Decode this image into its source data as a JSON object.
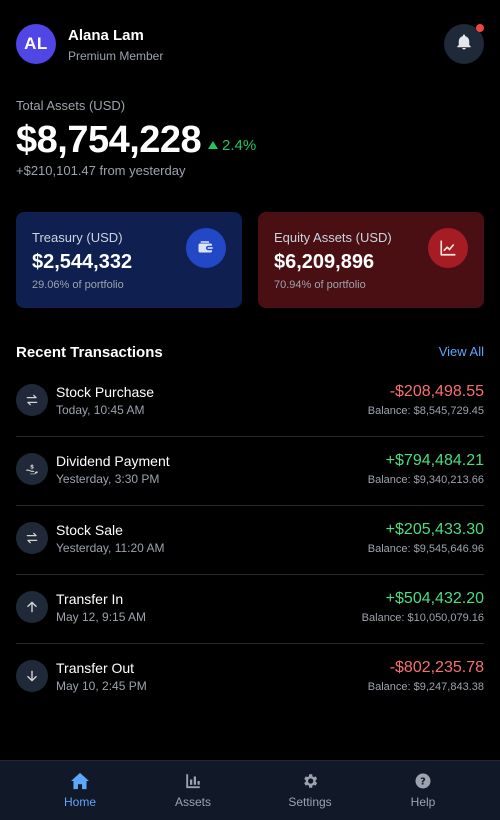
{
  "user": {
    "initials": "AL",
    "name": "Alana Lam",
    "tier": "Premium Member"
  },
  "notifications": {
    "icon": "bell-icon",
    "has_unread": true
  },
  "summary": {
    "label": "Total Assets (USD)",
    "value": "$8,754,228",
    "change_pct": "2.4%",
    "change_direction": "up",
    "change_abs": "+$210,101.47 from yesterday"
  },
  "cards": [
    {
      "label": "Treasury (USD)",
      "value": "$2,544,332",
      "sub": "29.06% of portfolio",
      "icon": "wallet-icon"
    },
    {
      "label": "Equity Assets (USD)",
      "value": "$6,209,896",
      "sub": "70.94% of portfolio",
      "icon": "chart-line-icon"
    }
  ],
  "transactions_section": {
    "title": "Recent Transactions",
    "view_all": "View All"
  },
  "transactions": [
    {
      "name": "Stock Purchase",
      "date": "Today, 10:45 AM",
      "amount": "-$208,498.55",
      "type": "neg",
      "balance": "Balance: $8,545,729.45",
      "icon": "exchange-icon"
    },
    {
      "name": "Dividend Payment",
      "date": "Yesterday, 3:30 PM",
      "amount": "+$794,484.21",
      "type": "pos",
      "balance": "Balance: $9,340,213.66",
      "icon": "hand-dollar-icon"
    },
    {
      "name": "Stock Sale",
      "date": "Yesterday, 11:20 AM",
      "amount": "+$205,433.30",
      "type": "pos",
      "balance": "Balance: $9,545,646.96",
      "icon": "exchange-icon"
    },
    {
      "name": "Transfer In",
      "date": "May 12, 9:15 AM",
      "amount": "+$504,432.20",
      "type": "pos",
      "balance": "Balance: $10,050,079.16",
      "icon": "arrow-up-icon"
    },
    {
      "name": "Transfer Out",
      "date": "May 10, 2:45 PM",
      "amount": "-$802,235.78",
      "type": "neg",
      "balance": "Balance: $9,247,843.38",
      "icon": "arrow-down-icon"
    }
  ],
  "nav": [
    {
      "label": "Home",
      "icon": "home-icon",
      "active": true
    },
    {
      "label": "Assets",
      "icon": "bar-chart-icon",
      "active": false
    },
    {
      "label": "Settings",
      "icon": "gear-icon",
      "active": false
    },
    {
      "label": "Help",
      "icon": "help-icon",
      "active": false
    }
  ],
  "colors": {
    "accent": "#60a5fa",
    "positive": "#4ade80",
    "negative": "#f87171",
    "avatar": "#4f46e5",
    "treasury_card": "#0f1f4f",
    "equity_card": "#4a0f12"
  }
}
